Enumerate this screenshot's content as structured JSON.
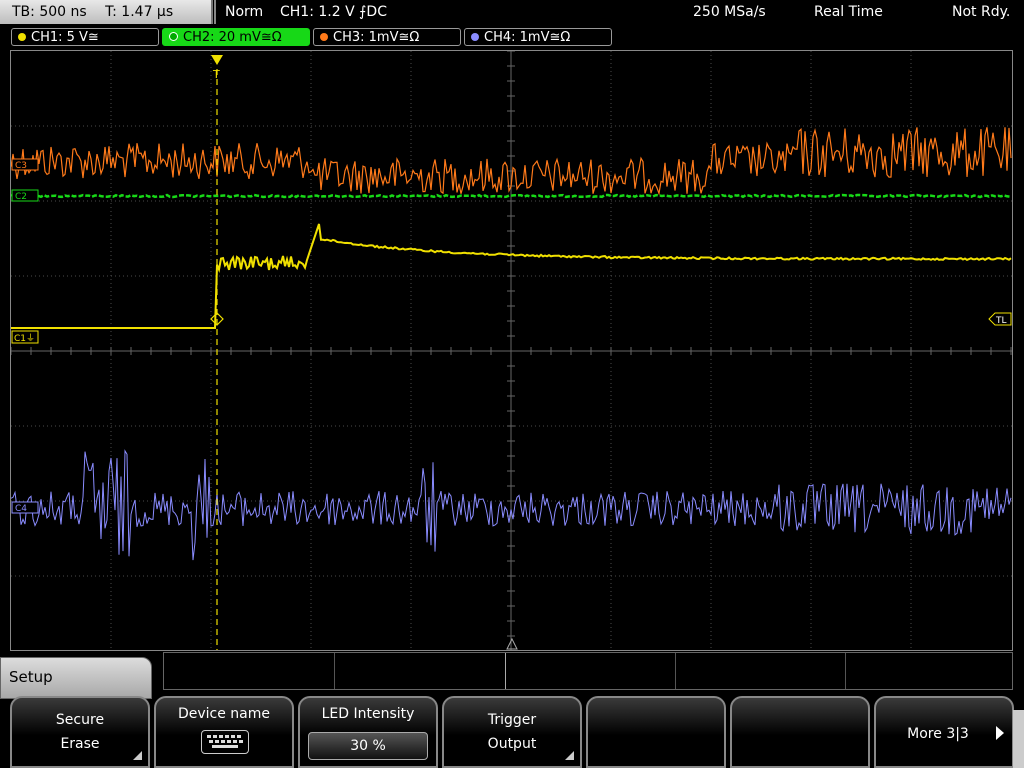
{
  "status_bar": {
    "timebase": "TB: 500 ns",
    "trigger_time": "T: 1.47 µs",
    "trigger_mode": "Norm",
    "trigger_source": "CH1: 1.2 V ⨍DC",
    "sample_rate": "250 MSa/s",
    "acq_mode": "Real Time",
    "status": "Not Rdy."
  },
  "channels": [
    {
      "label": "CH1: 5 V≅",
      "color": "#f0e000"
    },
    {
      "label": "CH2: 20 mV≅Ω",
      "color": "#17d817"
    },
    {
      "label": "CH3: 1mV≅Ω",
      "color": "#ff7a1a"
    },
    {
      "label": "CH4: 1mV≅Ω",
      "color": "#8a8cff"
    }
  ],
  "screen": {
    "trigger_marker": "T",
    "ch1_marker": "C1⏚",
    "ch2_marker": "C2",
    "ch3_marker": "C3",
    "ch4_marker": "C4",
    "trigger_level_marker": "TL"
  },
  "menu": {
    "title": "Setup",
    "softkeys": [
      {
        "line1": "Secure",
        "line2": "Erase"
      },
      {
        "line1": "Device name",
        "icon": "keyboard-icon"
      },
      {
        "line1": "LED Intensity",
        "value": "30 %"
      },
      {
        "line1": "Trigger",
        "line2": "Output"
      },
      {
        "line1": ""
      },
      {
        "line1": ""
      },
      {
        "line1": "More 3|3"
      }
    ]
  },
  "colors": {
    "ch1": "#f0e000",
    "ch2": "#17d817",
    "ch3": "#ff7a1a",
    "ch4": "#8a8cff",
    "grid": "#4a4a4a"
  }
}
